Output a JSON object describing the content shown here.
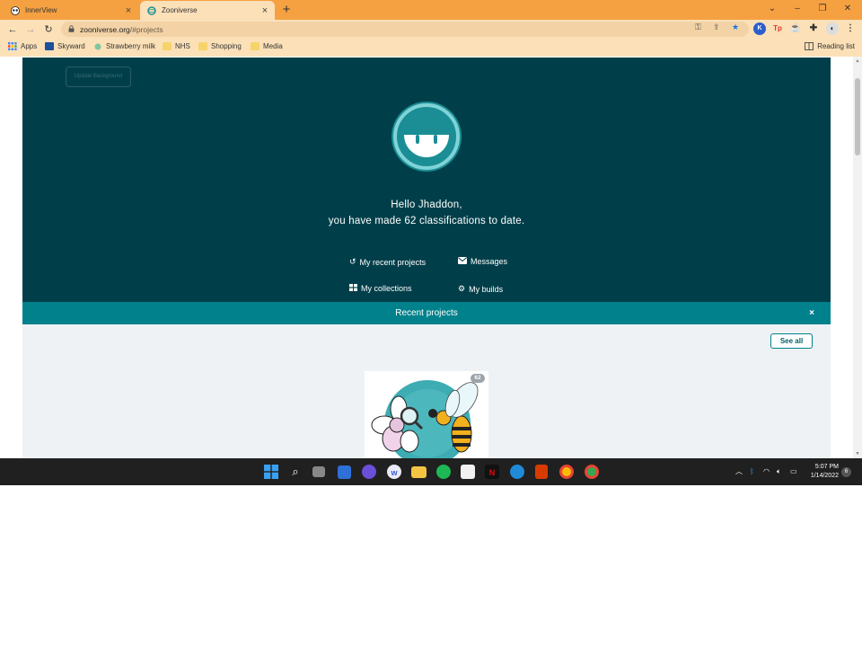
{
  "browser": {
    "tabs": [
      {
        "title": "InnerView",
        "active": false
      },
      {
        "title": "Zooniverse",
        "active": true
      }
    ],
    "url_host": "zooniverse.org",
    "url_path": "/#projects",
    "bookmarks": [
      "Apps",
      "Skyward",
      "Strawberry milk",
      "NHS",
      "Shopping",
      "Media"
    ],
    "reading_list": "Reading list",
    "extensions": [
      {
        "label": "K",
        "color": "#2b5fce"
      },
      {
        "label": "Tp",
        "color": "#e2352b"
      }
    ]
  },
  "page": {
    "update_background": "Update Background",
    "greeting_line1": "Hello Jhaddon,",
    "greeting_line2": "you have made 62 classifications to date.",
    "links": {
      "recent_projects": "My recent projects",
      "messages": "Messages",
      "collections": "My collections",
      "builds": "My builds"
    },
    "recent_projects_title": "Recent projects",
    "close_glyph": "×",
    "see_all": "See all",
    "project_card": {
      "badge": "62"
    }
  },
  "colors": {
    "hero_bg": "#003f4a",
    "recent_bar": "#00818b",
    "avatar": "#1b8e95",
    "tab_strip": "#f5a142"
  },
  "taskbar": {
    "time": "5:07 PM",
    "date": "1/14/2022",
    "notifications": "6"
  }
}
